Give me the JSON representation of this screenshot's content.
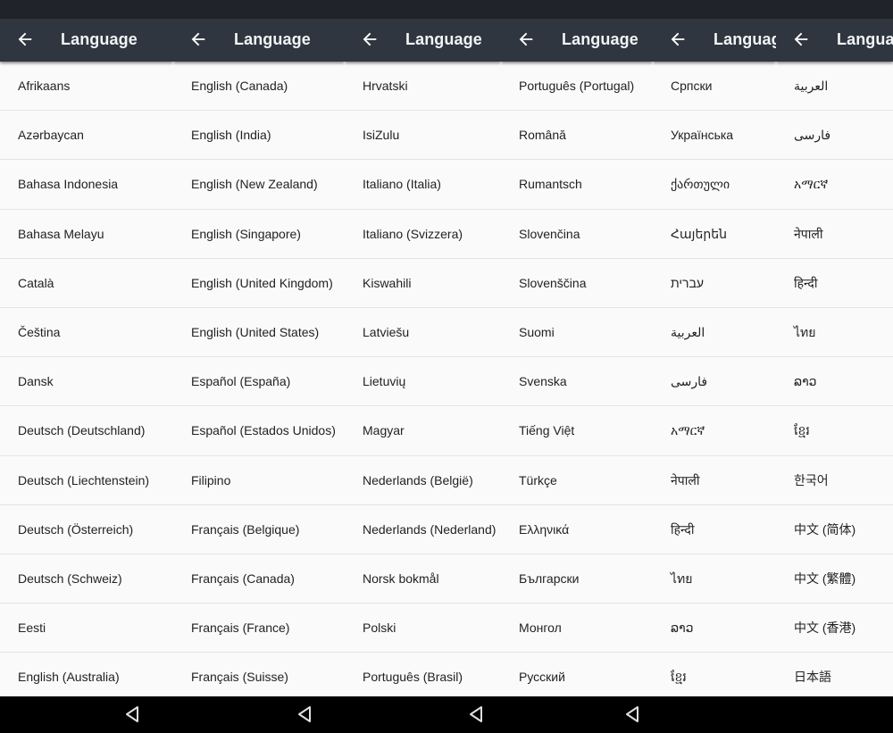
{
  "title": "Language",
  "panels": [
    {
      "items": [
        "Afrikaans",
        "Azərbaycan",
        "Bahasa Indonesia",
        "Bahasa Melayu",
        "Català",
        "Čeština",
        "Dansk",
        "Deutsch (Deutschland)",
        "Deutsch (Liechtenstein)",
        "Deutsch (Österreich)",
        "Deutsch (Schweiz)",
        "Eesti",
        "English (Australia)"
      ]
    },
    {
      "items": [
        "English (Canada)",
        "English (India)",
        "English (New Zealand)",
        "English (Singapore)",
        "English (United Kingdom)",
        "English (United States)",
        "Español (España)",
        "Español (Estados Unidos)",
        "Filipino",
        "Français (Belgique)",
        "Français (Canada)",
        "Français (France)",
        "Français (Suisse)"
      ]
    },
    {
      "items": [
        "Hrvatski",
        "IsiZulu",
        "Italiano (Italia)",
        "Italiano (Svizzera)",
        "Kiswahili",
        "Latviešu",
        "Lietuvių",
        "Magyar",
        "Nederlands (België)",
        "Nederlands (Nederland)",
        "Norsk bokmål",
        "Polski",
        "Português (Brasil)"
      ]
    },
    {
      "items": [
        "Português (Portugal)",
        "Română",
        "Rumantsch",
        "Slovenčina",
        "Slovenščina",
        "Suomi",
        "Svenska",
        "Tiếng Việt",
        "Türkçe",
        "Ελληνικά",
        "Български",
        "Монгол",
        "Русский"
      ]
    },
    {
      "items": [
        "Српски",
        "Українська",
        "ქართული",
        "Հայերեն",
        "עברית",
        "العربية",
        "فارسی",
        "አማርኛ",
        "नेपाली",
        "हिन्दी",
        "ไทย",
        "ລາວ",
        "ខ្មែរ"
      ]
    },
    {
      "items": [
        "العربية",
        "فارسی",
        "አማርኛ",
        "नेपाली",
        "हिन्दी",
        "ไทย",
        "ລາວ",
        "ខ្មែរ",
        "한국어",
        "中文 (简体)",
        "中文 (繁體)",
        "中文 (香港)",
        "日本語"
      ]
    }
  ],
  "icons": {
    "back": "arrow-back-icon",
    "nav_back": "nav-back-triangle-icon"
  },
  "colors": {
    "appbar": "#2f3640",
    "statusbar": "#202329",
    "list_bg": "#fafafa",
    "text": "#222222",
    "navbar": "#000000"
  }
}
